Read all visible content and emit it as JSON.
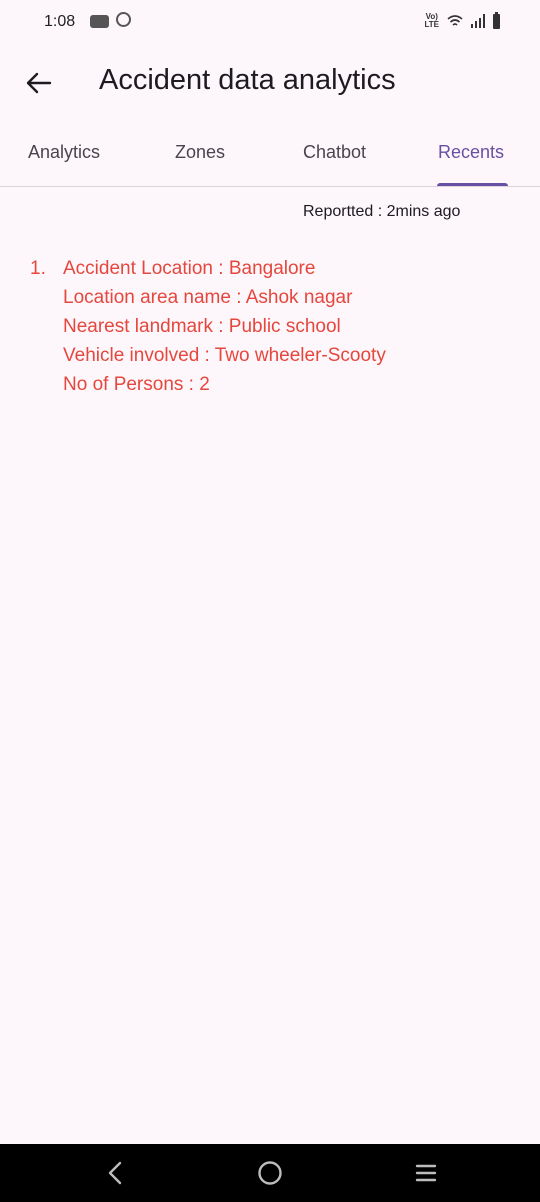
{
  "status_bar": {
    "time": "1:08",
    "network_label": "Vo) LTE",
    "icons": [
      "notification-app-icon",
      "music-app-icon",
      "volte-icon",
      "wifi-icon",
      "signal-icon",
      "battery-icon"
    ]
  },
  "app_bar": {
    "back_icon": "arrow-left-icon",
    "title": "Accident data analytics"
  },
  "tabs": [
    {
      "label": "Analytics",
      "active": false
    },
    {
      "label": "Zones",
      "active": false
    },
    {
      "label": "Chatbot",
      "active": false
    },
    {
      "label": "Recents",
      "active": true
    }
  ],
  "accent_color": "#6750a4",
  "report_color": "#e5473c",
  "reported_text": "Reportted : 2mins ago",
  "reports": [
    {
      "number": "1.",
      "lines": [
        "Accident Location : Bangalore",
        "Location area name : Ashok nagar",
        "Nearest landmark : Public school",
        "Vehicle involved : Two wheeler-Scooty",
        "No of Persons : 2"
      ]
    }
  ],
  "nav_bar": {
    "icons": [
      "back-triangle-icon",
      "home-circle-icon",
      "recents-menu-icon"
    ]
  }
}
